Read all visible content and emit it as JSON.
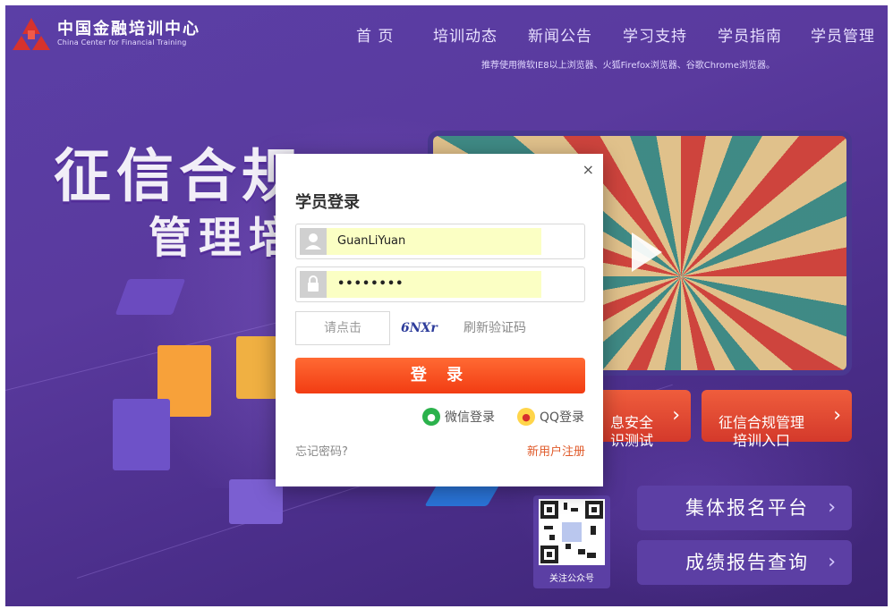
{
  "header": {
    "logo_title": "中国金融培训中心",
    "logo_subtitle": "China Center for Financial Training",
    "nav": [
      {
        "label": "首 页"
      },
      {
        "label": "培训动态"
      },
      {
        "label": "新闻公告"
      },
      {
        "label": "学习支持"
      },
      {
        "label": "学员指南"
      },
      {
        "label": "学员管理"
      }
    ],
    "browser_tip": "推荐使用微软IE8以上浏览器、火狐Firefox浏览器、谷歌Chrome浏览器。"
  },
  "hero": {
    "line1": "征信合规",
    "line2": "管理培"
  },
  "side_buttons": {
    "security_test": "息安全\n识测试",
    "compliance_entry": "征信合规管理\n培训入口",
    "group_signup": "集体报名平台",
    "score_query": "成绩报告查询",
    "qr_caption": "关注公众号"
  },
  "login": {
    "title": "学员登录",
    "close": "×",
    "username": "GuanLiYuan",
    "password": "••••••••",
    "captcha_placeholder": "请点击",
    "captcha_code": "6NXr",
    "captcha_refresh": "刷新验证码",
    "submit": "登 录",
    "wechat": "微信登录",
    "qq": "QQ登录",
    "forgot": "忘记密码?",
    "register": "新用户注册"
  },
  "icons": {
    "logo": "cctf-logo-icon",
    "user": "user-icon",
    "lock": "lock-icon",
    "wechat": "wechat-icon",
    "qq": "qq-icon",
    "play": "play-icon",
    "chevron": "chevron-right-icon"
  },
  "colors": {
    "background": "#5a3a9e",
    "accent_orange": "#f23c13",
    "logo_red": "#d7322d",
    "register_link": "#e05a2a"
  }
}
